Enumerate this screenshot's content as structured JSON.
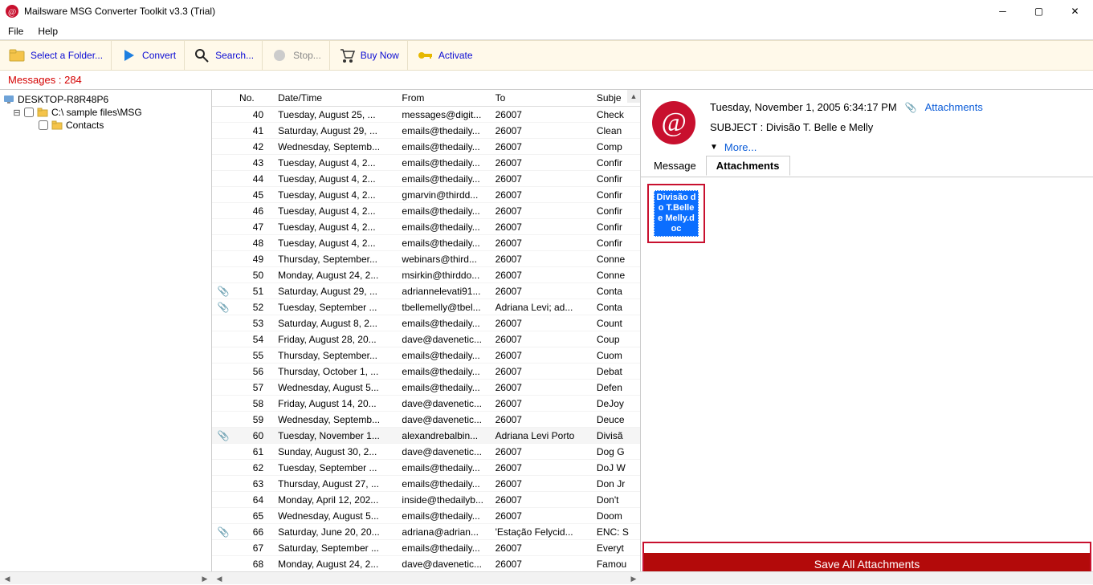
{
  "titlebar": {
    "title": "Mailsware MSG Converter Toolkit v3.3 (Trial)"
  },
  "menu": {
    "file": "File",
    "help": "Help"
  },
  "toolbar": {
    "select_folder": "Select a Folder...",
    "convert": "Convert",
    "search": "Search...",
    "stop": "Stop...",
    "buy": "Buy Now",
    "activate": "Activate"
  },
  "messages_count_label": "Messages : 284",
  "tree": {
    "root": "DESKTOP-R8R48P6",
    "drive": "C:\\                      sample files\\MSG",
    "contacts": "Contacts"
  },
  "list": {
    "headers": {
      "no": "No.",
      "datetime": "Date/Time",
      "from": "From",
      "to": "To",
      "subject": "Subje"
    },
    "rows": [
      {
        "clip": "",
        "no": "40",
        "dt": "Tuesday, August 25, ...",
        "from": "messages@digit...",
        "to": "26007",
        "subj": "Check"
      },
      {
        "clip": "",
        "no": "41",
        "dt": "Saturday, August 29, ...",
        "from": "emails@thedaily...",
        "to": "26007",
        "subj": "Clean"
      },
      {
        "clip": "",
        "no": "42",
        "dt": "Wednesday, Septemb...",
        "from": "emails@thedaily...",
        "to": "26007",
        "subj": "Comp"
      },
      {
        "clip": "",
        "no": "43",
        "dt": "Tuesday, August 4, 2...",
        "from": "emails@thedaily...",
        "to": "26007",
        "subj": "Confir"
      },
      {
        "clip": "",
        "no": "44",
        "dt": "Tuesday, August 4, 2...",
        "from": "emails@thedaily...",
        "to": "26007",
        "subj": "Confir"
      },
      {
        "clip": "",
        "no": "45",
        "dt": "Tuesday, August 4, 2...",
        "from": "gmarvin@thirdd...",
        "to": "26007",
        "subj": "Confir"
      },
      {
        "clip": "",
        "no": "46",
        "dt": "Tuesday, August 4, 2...",
        "from": "emails@thedaily...",
        "to": "26007",
        "subj": "Confir"
      },
      {
        "clip": "",
        "no": "47",
        "dt": "Tuesday, August 4, 2...",
        "from": "emails@thedaily...",
        "to": "26007",
        "subj": "Confir"
      },
      {
        "clip": "",
        "no": "48",
        "dt": "Tuesday, August 4, 2...",
        "from": "emails@thedaily...",
        "to": "26007",
        "subj": "Confir"
      },
      {
        "clip": "",
        "no": "49",
        "dt": "Thursday, September...",
        "from": "webinars@third...",
        "to": "26007",
        "subj": "Conne"
      },
      {
        "clip": "",
        "no": "50",
        "dt": "Monday, August 24, 2...",
        "from": "msirkin@thirddo...",
        "to": "26007",
        "subj": "Conne"
      },
      {
        "clip": "📎",
        "no": "51",
        "dt": "Saturday, August 29, ...",
        "from": "adriannelevati91...",
        "to": "26007",
        "subj": "Conta"
      },
      {
        "clip": "📎",
        "no": "52",
        "dt": "Tuesday, September ...",
        "from": "tbellemelly@tbel...",
        "to": "Adriana Levi; ad...",
        "subj": "Conta"
      },
      {
        "clip": "",
        "no": "53",
        "dt": "Saturday, August 8, 2...",
        "from": "emails@thedaily...",
        "to": "26007",
        "subj": "Count"
      },
      {
        "clip": "",
        "no": "54",
        "dt": "Friday, August 28, 20...",
        "from": "dave@davenetic...",
        "to": "26007",
        "subj": "Coup"
      },
      {
        "clip": "",
        "no": "55",
        "dt": "Thursday, September...",
        "from": "emails@thedaily...",
        "to": "26007",
        "subj": "Cuom"
      },
      {
        "clip": "",
        "no": "56",
        "dt": "Thursday, October 1, ...",
        "from": "emails@thedaily...",
        "to": "26007",
        "subj": "Debat"
      },
      {
        "clip": "",
        "no": "57",
        "dt": "Wednesday, August 5...",
        "from": "emails@thedaily...",
        "to": "26007",
        "subj": "Defen"
      },
      {
        "clip": "",
        "no": "58",
        "dt": "Friday, August 14, 20...",
        "from": "dave@davenetic...",
        "to": "26007",
        "subj": "DeJoy"
      },
      {
        "clip": "",
        "no": "59",
        "dt": "Wednesday, Septemb...",
        "from": "dave@davenetic...",
        "to": "26007",
        "subj": "Deuce"
      },
      {
        "clip": "📎",
        "no": "60",
        "dt": "Tuesday, November 1...",
        "from": "alexandrebalbin...",
        "to": "Adriana Levi Porto",
        "subj": "Divisã",
        "selected": true
      },
      {
        "clip": "",
        "no": "61",
        "dt": "Sunday, August 30, 2...",
        "from": "dave@davenetic...",
        "to": "26007",
        "subj": "Dog G"
      },
      {
        "clip": "",
        "no": "62",
        "dt": "Tuesday, September ...",
        "from": "emails@thedaily...",
        "to": "26007",
        "subj": "DoJ W"
      },
      {
        "clip": "",
        "no": "63",
        "dt": "Thursday, August 27, ...",
        "from": "emails@thedaily...",
        "to": "26007",
        "subj": "Don Jr"
      },
      {
        "clip": "",
        "no": "64",
        "dt": "Monday, April 12, 202...",
        "from": "inside@thedailyb...",
        "to": "26007",
        "subj": "Don't"
      },
      {
        "clip": "",
        "no": "65",
        "dt": "Wednesday, August 5...",
        "from": "emails@thedaily...",
        "to": "26007",
        "subj": "Doom"
      },
      {
        "clip": "📎",
        "no": "66",
        "dt": "Saturday, June 20, 20...",
        "from": "adriana@adrian...",
        "to": "'Estação Felycid...",
        "subj": "ENC: S"
      },
      {
        "clip": "",
        "no": "67",
        "dt": "Saturday, September ...",
        "from": "emails@thedaily...",
        "to": "26007",
        "subj": "Everyt"
      },
      {
        "clip": "",
        "no": "68",
        "dt": "Monday, August 24, 2...",
        "from": "dave@davenetic...",
        "to": "26007",
        "subj": "Famou"
      }
    ]
  },
  "preview": {
    "date": "Tuesday, November 1, 2005 6:34:17 PM",
    "attachments_link": "Attachments",
    "subject_label": "SUBJECT : ",
    "subject": "Divisão T. Belle e Melly",
    "more": "More...",
    "tab_message": "Message",
    "tab_attachments": "Attachments",
    "attachment_file": "Divisão do T.Belle e Melly.doc",
    "save_all": "Save All  Attachments"
  }
}
